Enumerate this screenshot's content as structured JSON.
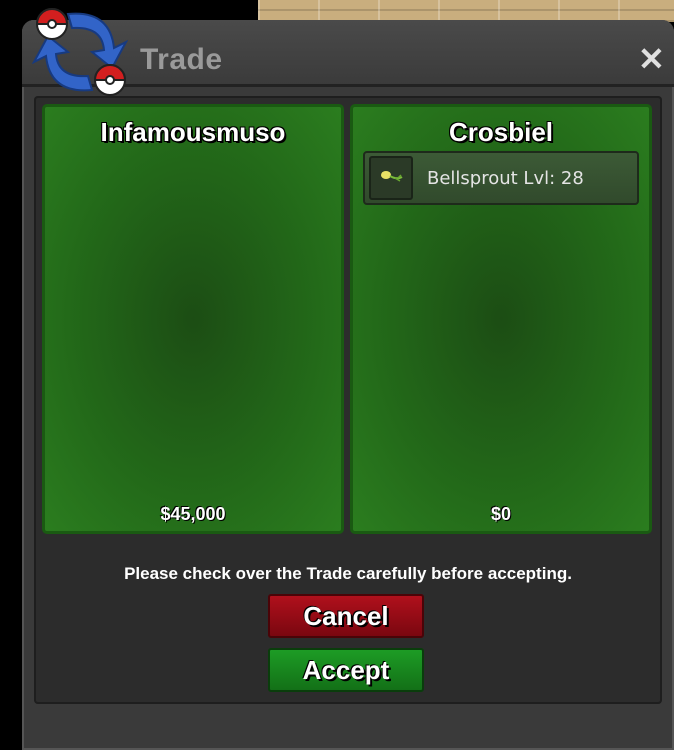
{
  "window": {
    "title": "Trade"
  },
  "left_panel": {
    "player": "Infamousmuso",
    "money": "$45,000"
  },
  "right_panel": {
    "player": "Crosbiel",
    "money": "$0",
    "items": [
      {
        "name": "Bellsprout  Lvl: 28"
      }
    ]
  },
  "notice": "Please check over the Trade carefully before accepting.",
  "buttons": {
    "cancel": "Cancel",
    "accept": "Accept"
  },
  "colors": {
    "cancel": "#b0101c",
    "accept": "#1d9c25",
    "panel_green": "#236a19"
  }
}
